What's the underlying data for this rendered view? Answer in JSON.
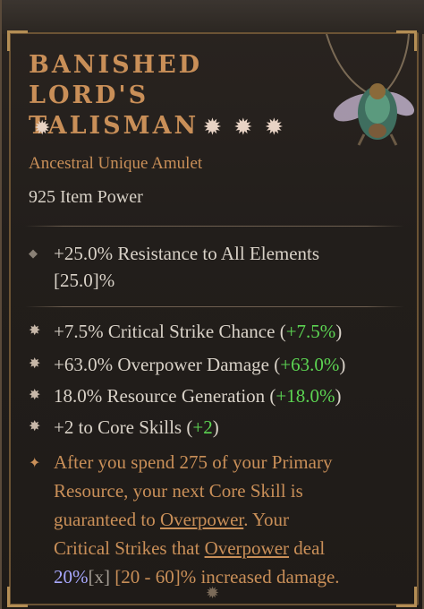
{
  "item": {
    "title_line1": "BANISHED LORD'S",
    "title_line2": "TALISMAN",
    "subtitle": "Ancestral Unique Amulet",
    "item_power": "925 Item Power"
  },
  "implicit": {
    "line1": "+25.0% Resistance to All Elements",
    "line2": "[25.0]%"
  },
  "affixes": [
    {
      "text": "+7.5% Critical Strike Chance (",
      "bonus": "+7.5%",
      "close": ")"
    },
    {
      "text": "+63.0% Overpower Damage (",
      "bonus": "+63.0%",
      "close": ")"
    },
    {
      "text": "18.0% Resource Generation (",
      "bonus": "+18.0%",
      "close": ")"
    },
    {
      "text": "+2 to Core Skills (",
      "bonus": "+2",
      "close": ")"
    }
  ],
  "unique_power": {
    "l1": "After you spend 275 of your Primary",
    "l2": "Resource, your next Core Skill is",
    "l3a": "guaranteed to ",
    "l3b": "Overpower",
    "l3c": ". Your",
    "l4a": "Critical Strikes that ",
    "l4b": "Overpower",
    "l4c": " deal",
    "l5a": "20%",
    "l5b": "[x]",
    "l5c": " [20 - 60]% increased damage."
  },
  "colors": {
    "title": "#c98f58",
    "bonus_green": "#5cd452",
    "scaling_blue": "#a8a8ff"
  },
  "icons": {
    "affix_bullet": "asterisk-icon",
    "implicit_bullet": "diamond-icon",
    "unique_bullet": "star-icon"
  }
}
